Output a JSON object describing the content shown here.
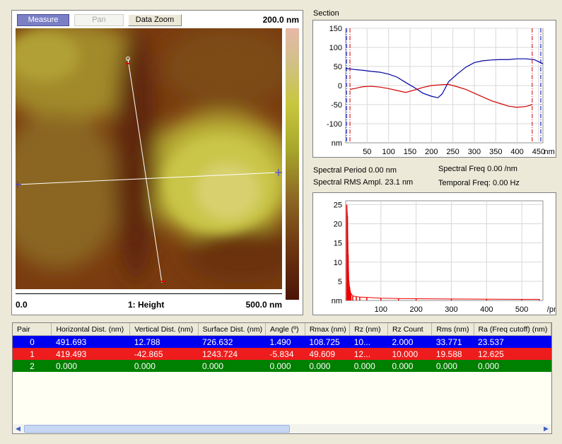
{
  "toolbar": {
    "measure": "Measure",
    "pan": "Pan",
    "data_zoom": "Data Zoom"
  },
  "image": {
    "z_range": "200.0 nm",
    "x_min": "0.0",
    "channel": "1: Height",
    "x_max": "500.0 nm"
  },
  "section": {
    "title": "Section",
    "y_ticks": [
      "150",
      "100",
      "50",
      "0",
      "-50",
      "-100",
      "nm"
    ],
    "x_ticks": [
      "50",
      "100",
      "150",
      "200",
      "250",
      "300",
      "350",
      "400",
      "450",
      "nm"
    ]
  },
  "stats": {
    "spectral_period": "Spectral Period 0.00 nm",
    "spectral_freq": "Spectral Freq 0.00 /nm",
    "rms_ampl": "Spectral RMS Ampl. 23.1 nm",
    "temporal_freq": "Temporal Freq: 0.00 Hz"
  },
  "spectrum": {
    "y_ticks": [
      "25",
      "20",
      "15",
      "10",
      "5",
      "nm"
    ],
    "x_ticks": [
      "100",
      "200",
      "300",
      "400",
      "500",
      "/pm"
    ]
  },
  "table": {
    "headers": [
      "Pair",
      "Horizontal Dist. (nm)",
      "Vertical Dist. (nm)",
      "Surface Dist. (nm)",
      "Angle (º)",
      "Rmax (nm)",
      "Rz  (nm)",
      "Rz Count",
      "Rms (nm)",
      "Ra (Freq cutoff) (nm)"
    ],
    "rows": [
      [
        "0",
        "491.693",
        "12.788",
        "726.632",
        "1.490",
        "108.725",
        "10...",
        "2.000",
        "33.771",
        "23.537"
      ],
      [
        "1",
        "419.493",
        "-42.865",
        "1243.724",
        "-5.834",
        "49.609",
        "12...",
        "10.000",
        "19.588",
        "12.625"
      ],
      [
        "2",
        "0.000",
        "0.000",
        "0.000",
        "0.000",
        "0.000",
        "0.000",
        "0.000",
        "0.000",
        "0.000"
      ]
    ],
    "row_colors": [
      "#0000f0",
      "#ee1c1c",
      "#008000"
    ]
  },
  "chart_data": [
    {
      "type": "line",
      "title": "Section",
      "xlabel": "nm",
      "ylabel": "nm",
      "xlim": [
        0,
        460
      ],
      "ylim": [
        -150,
        150
      ],
      "grid": true,
      "series": [
        {
          "color": "#0000a0",
          "x": [
            0,
            20,
            40,
            60,
            80,
            100,
            120,
            140,
            160,
            180,
            200,
            215,
            225,
            240,
            260,
            280,
            300,
            320,
            340,
            360,
            380,
            400,
            420,
            440,
            460
          ],
          "y": [
            45,
            42,
            40,
            37,
            35,
            30,
            22,
            8,
            -5,
            -20,
            -28,
            -32,
            -22,
            10,
            30,
            48,
            60,
            65,
            67,
            68,
            68,
            70,
            70,
            68,
            57
          ]
        },
        {
          "color": "#d00000",
          "x": [
            10,
            20,
            40,
            60,
            80,
            100,
            120,
            140,
            160,
            180,
            200,
            220,
            240,
            260,
            280,
            300,
            320,
            340,
            360,
            380,
            400,
            420,
            435
          ],
          "y": [
            -10,
            -8,
            -3,
            -2,
            -4,
            -8,
            -13,
            -18,
            -12,
            -5,
            0,
            2,
            3,
            -3,
            -10,
            -20,
            -30,
            -40,
            -47,
            -54,
            -57,
            -55,
            -50
          ]
        }
      ],
      "markers": [
        {
          "color": "#0000c0",
          "x": [
            2,
            455
          ]
        },
        {
          "color": "#d00000",
          "x": [
            10,
            435
          ]
        }
      ]
    },
    {
      "type": "line",
      "xlabel": "/pm",
      "ylabel": "nm",
      "xlim": [
        0,
        560
      ],
      "ylim": [
        0,
        26
      ],
      "grid": true,
      "series": [
        {
          "color": "#ee0000",
          "x": [
            3,
            5,
            7,
            9,
            11,
            13,
            15,
            20,
            30,
            40,
            60,
            100,
            150,
            200,
            300,
            400,
            500,
            550
          ],
          "y": [
            25,
            22,
            12,
            5,
            3.5,
            2.4,
            1.8,
            1.2,
            1.0,
            0.9,
            0.8,
            0.6,
            0.5,
            0.45,
            0.4,
            0.35,
            0.3,
            0.3
          ]
        }
      ]
    }
  ]
}
